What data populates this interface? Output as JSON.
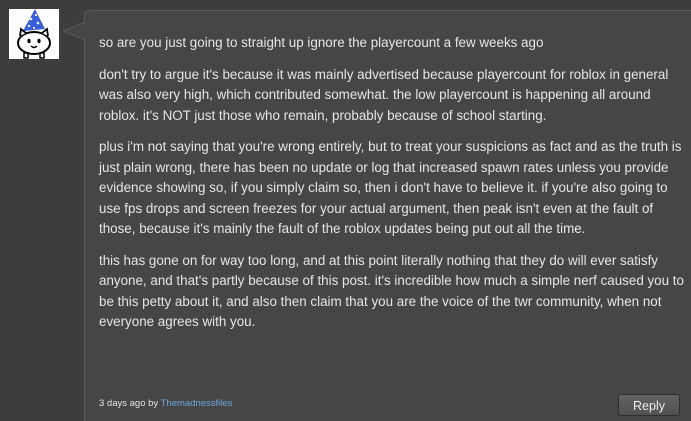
{
  "comment": {
    "paragraphs": [
      "so are you just going to straight up ignore the playercount a few weeks ago",
      "don't try to argue it's because it was mainly advertised because playercount for roblox in general was also very high, which contributed somewhat. the low playercount is happening all around roblox. it's NOT just those who remain, probably because of school starting.",
      "plus i'm not saying that you're wrong entirely, but to treat your suspicions as fact and as the truth is just plain wrong, there has been no update or log that increased spawn rates unless you provide evidence showing so, if you simply claim so, then i don't have to believe it. if you're also going to use fps drops and screen freezes for your actual argument, then peak isn't even at the fault of those, because it's mainly the fault of the roblox updates being put out all the time.",
      "this has gone on for way too long, and at this point literally nothing that they do will ever satisfy anyone, and that's partly because of this post. it's incredible how much a simple nerf caused you to be this petty about it, and also then claim that you are the voice of the twr community, when not everyone agrees with you."
    ],
    "timestamp": "3 days ago by",
    "author": "Themadnessfiles",
    "reply_label": "Reply",
    "avatar_icon": "battle-cat-party-hat-avatar"
  },
  "colors": {
    "background": "#3d3d3d",
    "bubble": "#464646",
    "text": "#e6e6e6",
    "link": "#6fa8dc"
  }
}
